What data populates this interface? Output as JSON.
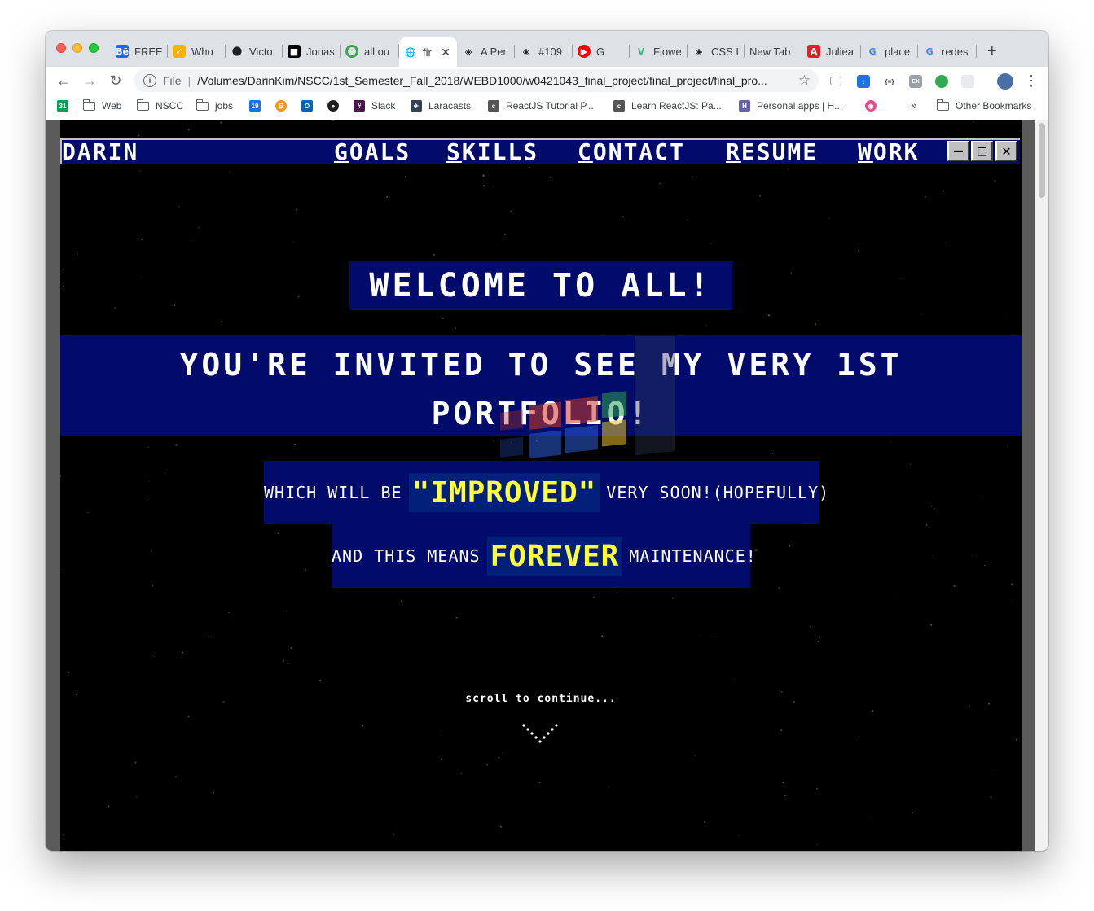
{
  "browser": {
    "tabs": [
      {
        "label": "FREE",
        "icon": "behance-icon",
        "color": "#1769ff",
        "glyph": "Bē"
      },
      {
        "label": "Who",
        "icon": "shield-icon",
        "color": "#f4b400",
        "glyph": "✓"
      },
      {
        "label": "Victo",
        "icon": "dot-icon",
        "color": "#202124",
        "glyph": ""
      },
      {
        "label": "Jonas",
        "icon": "square-icon",
        "color": "#000000",
        "glyph": "■"
      },
      {
        "label": "all ou",
        "icon": "ring-icon",
        "color": "#34a853",
        "glyph": ""
      },
      {
        "label": "fir",
        "icon": "globe-icon",
        "color": "#5f6368",
        "glyph": "🌐",
        "active": true
      },
      {
        "label": "A Per",
        "icon": "codepen-icon",
        "color": "#202124",
        "glyph": "◈"
      },
      {
        "label": "#109",
        "icon": "codepen-icon",
        "color": "#202124",
        "glyph": "◈"
      },
      {
        "label": "G",
        "icon": "youtube-music-icon",
        "color": "#ff0000",
        "glyph": "▶"
      },
      {
        "label": "Flowe",
        "icon": "vue-icon",
        "color": "#41b883",
        "glyph": "V"
      },
      {
        "label": "CSS I",
        "icon": "codepen-icon",
        "color": "#202124",
        "glyph": "◈"
      },
      {
        "label": "New Tab",
        "icon": "none",
        "color": "",
        "glyph": ""
      },
      {
        "label": "Juliea",
        "icon": "adobe-icon",
        "color": "#e81e25",
        "glyph": "A"
      },
      {
        "label": "place",
        "icon": "google-icon",
        "color": "#4285f4",
        "glyph": "G"
      },
      {
        "label": "redes",
        "icon": "google-icon",
        "color": "#4285f4",
        "glyph": "G"
      }
    ],
    "new_tab": "+",
    "close_tab": "✕",
    "back": "←",
    "forward": "→",
    "reload": "↻",
    "omnibox": {
      "info": "i",
      "scheme": "File",
      "url": "/Volumes/DarinKim/NSCC/1st_Semester_Fall_2018/WEBD1000/w0421043_final_project/final_project/final_pro...",
      "star": "☆"
    },
    "menu": "⋮",
    "bookmarks": [
      {
        "label": "",
        "icon": "calendar-green-icon",
        "color": "#0f9d58",
        "glyph": "31"
      },
      {
        "label": "Web",
        "icon": "folder-icon"
      },
      {
        "label": "NSCC",
        "icon": "folder-icon"
      },
      {
        "label": "jobs",
        "icon": "folder-icon"
      },
      {
        "label": "",
        "icon": "calendar-icon",
        "color": "#1a73e8",
        "glyph": "19"
      },
      {
        "label": "",
        "icon": "bitcoin-icon",
        "color": "#f7931a",
        "glyph": "₿"
      },
      {
        "label": "",
        "icon": "outlook-icon",
        "color": "#0364b8",
        "glyph": "O"
      },
      {
        "label": "",
        "icon": "github-icon",
        "color": "#202124",
        "glyph": "●"
      },
      {
        "label": "Slack",
        "icon": "slack-icon",
        "color": "#4a154b",
        "glyph": "#"
      },
      {
        "label": "Laracasts",
        "icon": "laracasts-icon",
        "color": "#334155",
        "glyph": "✈"
      },
      {
        "label": "ReactJS Tutorial P...",
        "icon": "doc-icon",
        "color": "#555555",
        "glyph": "c"
      },
      {
        "label": "Learn ReactJS: Pa...",
        "icon": "doc-icon",
        "color": "#555555",
        "glyph": "c"
      },
      {
        "label": "Personal apps | H...",
        "icon": "heroku-icon",
        "color": "#6762a6",
        "glyph": "H"
      },
      {
        "label": "",
        "icon": "dribbble-icon",
        "color": "#ea4c89",
        "glyph": "◉"
      }
    ],
    "more_bookmarks": "»",
    "other_bookmarks": "Other Bookmarks"
  },
  "site": {
    "brand": "DARIN",
    "nav": [
      {
        "first": "G",
        "rest": "OALS"
      },
      {
        "first": "S",
        "rest": "KILLS"
      },
      {
        "first": "C",
        "rest": "ONTACT"
      },
      {
        "first": "R",
        "rest": "ESUME"
      },
      {
        "first": "W",
        "rest": "ORK"
      }
    ],
    "window_buttons": {
      "minimize": "—",
      "maximize": "□",
      "close": "✕"
    },
    "welcome": "WELCOME TO ALL!",
    "invite_line1": "YOU'RE INVITED TO SEE MY VERY 1ST",
    "invite_line2": "PORTFOLIO!",
    "line1": {
      "before": "WHICH WILL BE",
      "highlight": "\"IMPROVED\"",
      "after": "VERY SOON!(HOPEFULLY)"
    },
    "line2": {
      "before": "AND THIS MEANS",
      "highlight": "FOREVER",
      "after": "MAINTENANCE!"
    },
    "scroll_hint": "scroll to continue...",
    "colors": {
      "nav_bg": "#000b6b",
      "highlight_text": "#ffff33",
      "page_bg": "#000000"
    }
  }
}
